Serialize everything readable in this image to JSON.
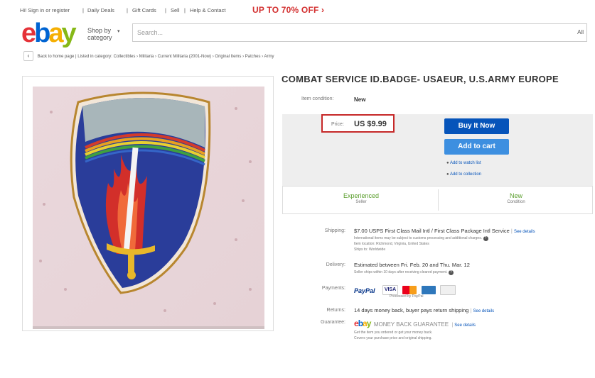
{
  "topbar": {
    "greeting": "Hi! Sign in or register",
    "links": [
      "Daily Deals",
      "Gift Cards",
      "Sell",
      "Help & Contact"
    ],
    "promo": "UP TO 70% OFF ›"
  },
  "header": {
    "shop_by": "Shop by category",
    "search_placeholder": "Search...",
    "all_categories": "All"
  },
  "breadcrumb": {
    "back_label": "Back to home page",
    "listed_in": "Listed in category:",
    "path": [
      "Collectibles",
      "Militaria",
      "Current Militaria (2001-Now)",
      "Original Items",
      "Patches",
      "Army"
    ]
  },
  "listing": {
    "title": "COMBAT SERVICE ID.BADGE- USAEUR, U.S.ARMY EUROPE",
    "condition_label": "Item condition:",
    "condition_value": "New",
    "price_label": "Price:",
    "price_value": "US $9.99",
    "buy_now": "Buy It Now",
    "add_to_cart": "Add to cart",
    "watch_list": "Add to watch list",
    "collection": "Add to collection",
    "seller_stat": "Experienced",
    "seller_stat_sub": "Seller",
    "condition_stat": "New",
    "condition_stat_sub": "Condition"
  },
  "shipping": {
    "label": "Shipping:",
    "value": "$7.00  USPS First Class Mail Intl / First Class Package Intl Service",
    "details": "See details",
    "note": "International items may be subject to customs processing and additional charges.",
    "location": "Item location:  Richmond, Virginia, United States",
    "ships_to": "Ships to:  Worldwide"
  },
  "delivery": {
    "label": "Delivery:",
    "value": "Estimated between Fri. Feb. 20 and Thu. Mar. 12",
    "note": "Seller ships within 10 days after receiving cleared payment."
  },
  "payments": {
    "label": "Payments:",
    "paypal": "PayPal",
    "processed": "Processed by PayPal"
  },
  "returns": {
    "label": "Returns:",
    "value": "14 days money back, buyer pays return shipping",
    "details": "See details"
  },
  "guarantee": {
    "label": "Guarantee:",
    "value": "MONEY BACK GUARANTEE",
    "details": "See details",
    "line1": "Get the item you ordered or get your money back.",
    "line2": "Covers your purchase price and original shipping."
  },
  "colors": {
    "ebay_red": "#e53238",
    "ebay_blue": "#0064d2",
    "ebay_yellow": "#f5af02",
    "ebay_green": "#86b817",
    "buy_now_bg": "#0654ba",
    "add_to_cart_bg": "#3d8fe0",
    "price_highlight_border": "#c62828"
  }
}
